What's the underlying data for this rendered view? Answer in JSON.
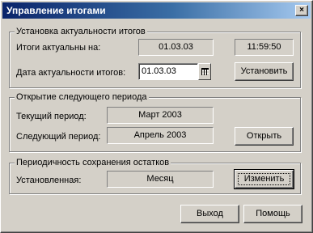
{
  "window": {
    "title": "Управление итогами",
    "close_glyph": "×"
  },
  "relevance": {
    "legend": "Установка актуальности итогов",
    "current_label": "Итоги актуальны на:",
    "current_date": "01.03.03",
    "current_time": "11:59:50",
    "date_label": "Дата актуальности итогов:",
    "date_value": "01.03.03",
    "set_button": "Установить"
  },
  "period": {
    "legend": "Открытие следующего периода",
    "current_label": "Текущий период:",
    "current_value": "Март 2003",
    "next_label": "Следующий период:",
    "next_value": "Апрель 2003",
    "open_button": "Открыть"
  },
  "periodicity": {
    "legend": "Периодичность сохранения остатков",
    "set_label": "Установленная:",
    "set_value": "Месяц",
    "change_button": "Изменить"
  },
  "footer": {
    "exit_button": "Выход",
    "help_button": "Помощь"
  }
}
